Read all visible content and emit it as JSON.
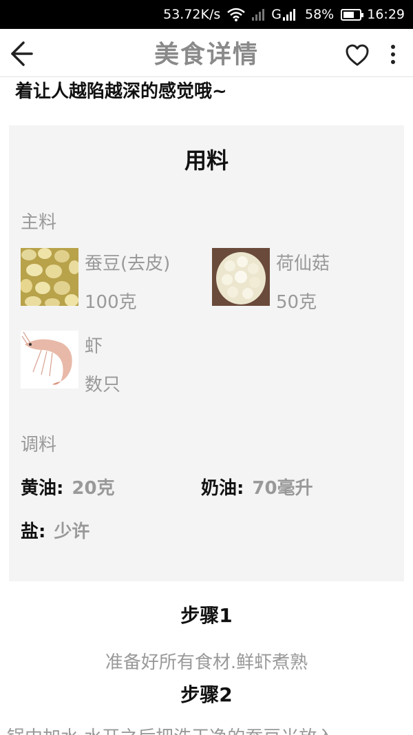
{
  "status_bar": {
    "speed": "53.72K/s",
    "network": "G",
    "battery": "58%",
    "time": "16:29"
  },
  "app_bar": {
    "title": "美食详情"
  },
  "intro_tail": "着让人越陷越深的感觉哦~",
  "ingredients": {
    "title": "用料",
    "main_label": "主料",
    "main_items": [
      {
        "name": "蚕豆(去皮)",
        "qty": "100克",
        "icon": "fava-beans-photo"
      },
      {
        "name": "荷仙菇",
        "qty": "50克",
        "icon": "mushroom-photo"
      },
      {
        "name": "虾",
        "qty": "数只",
        "icon": "shrimp-photo"
      }
    ],
    "seasoning_label": "调料",
    "seasonings": [
      {
        "name": "黄油:",
        "amount": "20克"
      },
      {
        "name": "奶油:",
        "amount": "70毫升"
      },
      {
        "name": "盐:",
        "amount": "少许"
      }
    ]
  },
  "steps": [
    {
      "title": "步骤1",
      "desc": "准备好所有食材.鲜虾煮熟"
    },
    {
      "title": "步骤2",
      "desc": "锅中加水,水开之后把洗干净的蚕豆米放入"
    }
  ],
  "colors": {
    "title_gray": "#8a8a8a",
    "muted_text": "#999999",
    "card_bg": "#f4f4f4"
  }
}
